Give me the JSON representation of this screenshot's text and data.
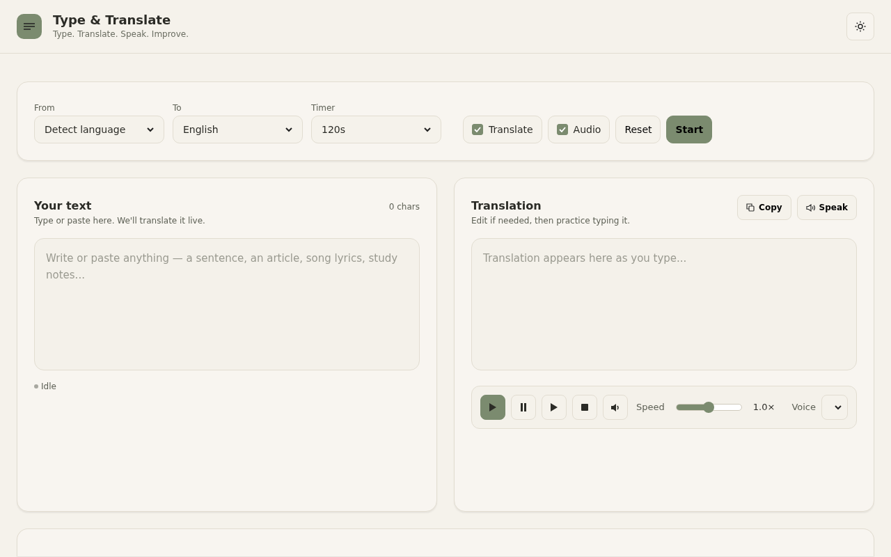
{
  "header": {
    "title": "Type & Translate",
    "subtitle": "Type. Translate. Speak. Improve."
  },
  "controls": {
    "selects": [
      {
        "label": "From",
        "value": "Detect language"
      },
      {
        "label": "To",
        "value": "English"
      },
      {
        "label": "Timer",
        "value": "120s"
      }
    ],
    "toggles": [
      {
        "label": "Translate",
        "checked": true
      },
      {
        "label": "Audio",
        "checked": true
      }
    ],
    "buttons": [
      {
        "label": "Reset",
        "kind": "secondary"
      },
      {
        "label": "Start",
        "kind": "primary"
      }
    ]
  },
  "source": {
    "title": "Your text",
    "subtitle": "Type or paste here. We'll translate it live.",
    "count": "0 chars",
    "placeholder": "Write or paste anything — a sentence, an article, song lyrics, study notes...",
    "status": "Idle"
  },
  "translation": {
    "title": "Translation",
    "subtitle": "Edit if needed, then practice typing it.",
    "actions": [
      {
        "label": "Copy",
        "kind": "copy"
      },
      {
        "label": "Speak",
        "kind": "speak"
      }
    ],
    "placeholder": "Translation appears here as you type...",
    "player": {
      "buttons": [
        {
          "kind": "play",
          "selected": true
        },
        {
          "kind": "pause",
          "selected": false
        },
        {
          "kind": "resume",
          "selected": false
        },
        {
          "kind": "stop",
          "selected": false
        },
        {
          "kind": "volume",
          "selected": false
        }
      ],
      "speed_label": "Speed",
      "level": 0.5,
      "speed": "1.0×",
      "voice_label": "Voice"
    }
  }
}
